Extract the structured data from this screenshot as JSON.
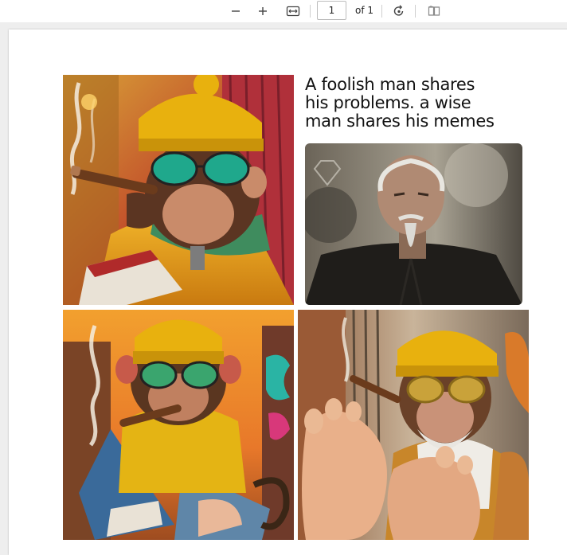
{
  "toolbar": {
    "zoom_out_icon": "minus-icon",
    "zoom_in_icon": "plus-icon",
    "fit_icon": "fit-width-icon",
    "page_number": "1",
    "page_total": "of 1",
    "rotate_icon": "rotate-icon",
    "view_icon": "two-page-view-icon"
  },
  "meme": {
    "line1": "A foolish man shares",
    "line2": "his problems. a wise",
    "line3": "man shares his memes"
  },
  "colors": {
    "page": "#ffffff",
    "viewer_bg": "#eeeeee",
    "hat_yellow": "#e8b10e"
  }
}
